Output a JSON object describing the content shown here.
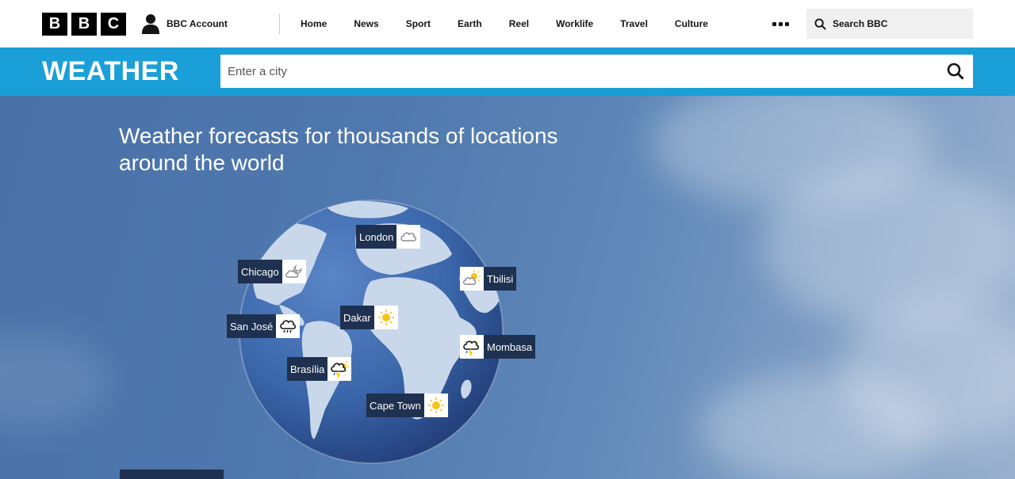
{
  "brand": {
    "letters": [
      "B",
      "B",
      "C"
    ]
  },
  "account": {
    "label": "BBC Account"
  },
  "nav": {
    "items": [
      "Home",
      "News",
      "Sport",
      "Earth",
      "Reel",
      "Worklife",
      "Travel",
      "Culture"
    ]
  },
  "search_bbc": {
    "label": "Search BBC"
  },
  "weather": {
    "title": "WEATHER",
    "city_placeholder": "Enter a city"
  },
  "hero": {
    "headline_line1": "Weather forecasts for thousands of locations",
    "headline_line2": "around the world"
  },
  "cities": [
    {
      "name": "London",
      "icon": "cloud-icon"
    },
    {
      "name": "Chicago",
      "icon": "partly-cloudy-night-icon"
    },
    {
      "name": "Tbilisi",
      "icon": "sunny-intervals-icon"
    },
    {
      "name": "Dakar",
      "icon": "sun-icon"
    },
    {
      "name": "San José",
      "icon": "light-rain-cloud-icon"
    },
    {
      "name": "Mombasa",
      "icon": "thundery-showers-icon"
    },
    {
      "name": "Brasília",
      "icon": "thundery-showers-sun-icon"
    },
    {
      "name": "Cape Town",
      "icon": "sun-icon"
    }
  ],
  "colors": {
    "weather_bar": "#1a9fd8",
    "label_bg": "#1e3150",
    "sun": "#f7c31c"
  }
}
